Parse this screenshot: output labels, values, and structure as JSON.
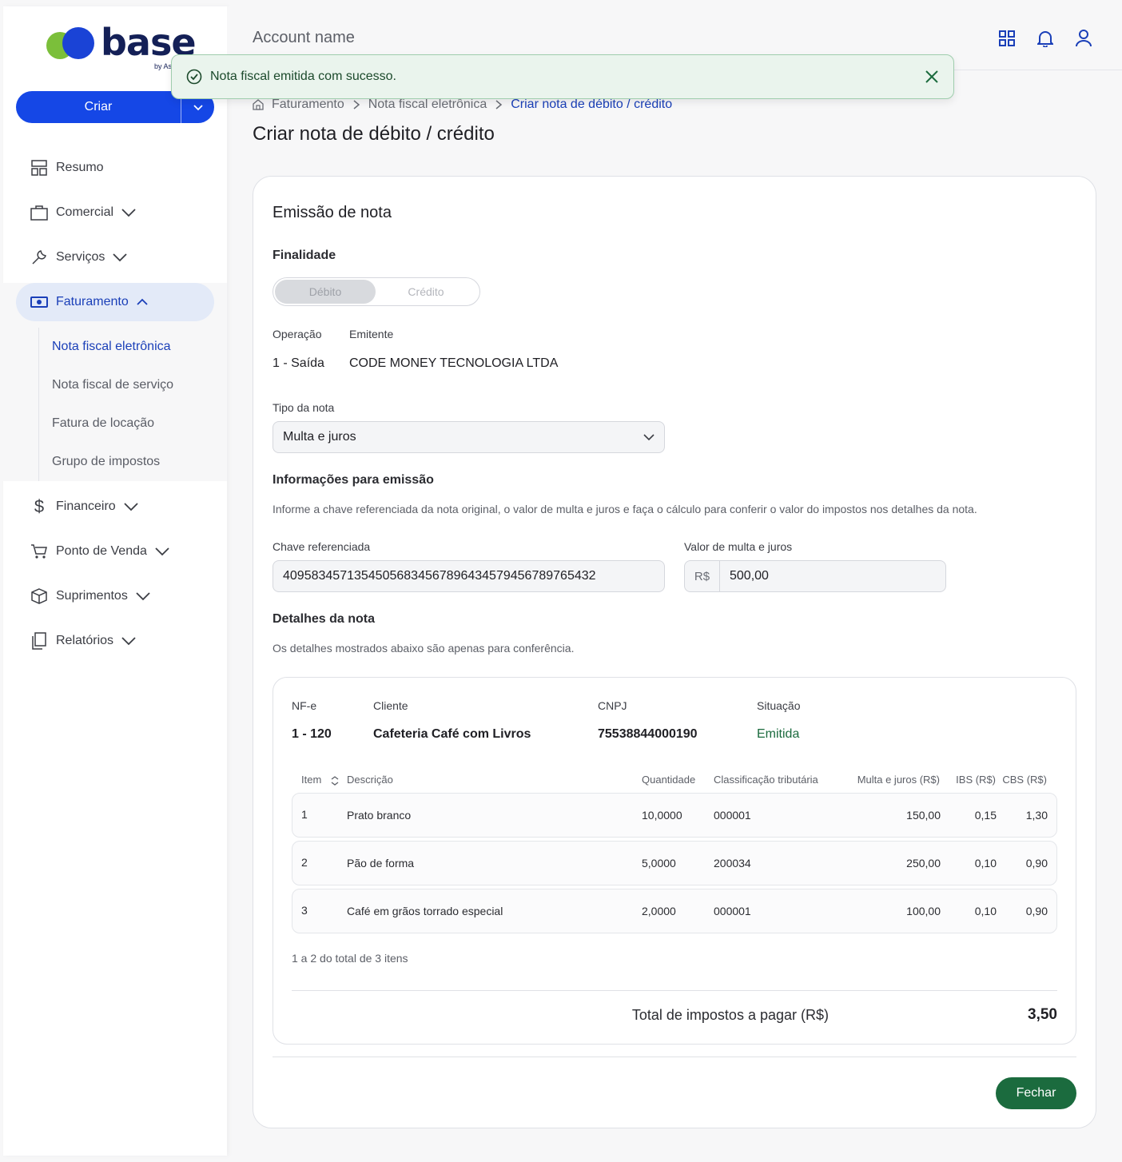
{
  "sidebar": {
    "logo_text": "base",
    "logo_by": "by As",
    "create_label": "Criar",
    "items": [
      {
        "label": "Resumo"
      },
      {
        "label": "Comercial"
      },
      {
        "label": "Serviços"
      },
      {
        "label": "Faturamento"
      },
      {
        "label": "Financeiro"
      },
      {
        "label": "Ponto de Venda"
      },
      {
        "label": "Suprimentos"
      },
      {
        "label": "Relatórios"
      }
    ],
    "sub_items": [
      {
        "label": "Nota fiscal eletrônica"
      },
      {
        "label": "Nota fiscal de serviço"
      },
      {
        "label": "Fatura de locação"
      },
      {
        "label": "Grupo de impostos"
      }
    ]
  },
  "header": {
    "account_name": "Account name"
  },
  "toast": {
    "message": "Nota fiscal emitida com sucesso."
  },
  "breadcrumb": [
    "Faturamento",
    "Nota fiscal eletrônica",
    "Criar nota de débito / crédito"
  ],
  "page_title": "Criar nota de débito / crédito",
  "form": {
    "section_title": "Emissão de nota",
    "finalidade_label": "Finalidade",
    "toggle": {
      "debito": "Débito",
      "credito": "Crédito"
    },
    "operacao_label": "Operação",
    "operacao_value": "1 - Saída",
    "emitente_label": "Emitente",
    "emitente_value": "CODE MONEY TECNOLOGIA LTDA",
    "tipo_label": "Tipo da nota",
    "tipo_value": "Multa e juros",
    "info_title": "Informações para emissão",
    "info_help": "Informe a chave referenciada da nota original, o valor de multa e juros e faça o cálculo para conferir o valor do impostos nos detalhes da nota.",
    "chave_label": "Chave referenciada",
    "chave_value": "409583457135450568345678964345794567897654 32",
    "valor_label": "Valor de multa e juros",
    "valor_prefix": "R$",
    "valor_value": "500,00",
    "detalhes_title": "Detalhes da nota",
    "detalhes_help": "Os detalhes mostrados abaixo são apenas para conferência."
  },
  "nota": {
    "nfe_label": "NF-e",
    "nfe_value": "1 - 120",
    "cliente_label": "Cliente",
    "cliente_value": "Cafeteria Café com Livros",
    "cnpj_label": "CNPJ",
    "cnpj_value": "75538844000190",
    "situacao_label": "Situação",
    "situacao_value": "Emitida",
    "columns": {
      "item": "Item",
      "descricao": "Descrição",
      "quantidade": "Quantidade",
      "classificacao": "Classificação tributária",
      "multa": "Multa e juros (R$)",
      "ibs": "IBS (R$)",
      "cbs": "CBS (R$)"
    },
    "rows": [
      {
        "item": "1",
        "descricao": "Prato branco",
        "quantidade": "10,0000",
        "classificacao": "000001",
        "multa": "150,00",
        "ibs": "0,15",
        "cbs": "1,30"
      },
      {
        "item": "2",
        "descricao": "Pão de forma",
        "quantidade": "5,0000",
        "classificacao": "200034",
        "multa": "250,00",
        "ibs": "0,10",
        "cbs": "0,90"
      },
      {
        "item": "3",
        "descricao": "Café em grãos torrado especial",
        "quantidade": "2,0000",
        "classificacao": "000001",
        "multa": "100,00",
        "ibs": "0,10",
        "cbs": "0,90"
      }
    ],
    "pagination": "1 a 2 do total de 3 itens",
    "total_label": "Total de impostos a pagar (R$)",
    "total_value": "3,50"
  },
  "actions": {
    "close_label": "Fechar"
  },
  "colors": {
    "primary": "#1547e6",
    "success": "#1b6b3e",
    "nav_active_bg": "#e3eaf8"
  }
}
